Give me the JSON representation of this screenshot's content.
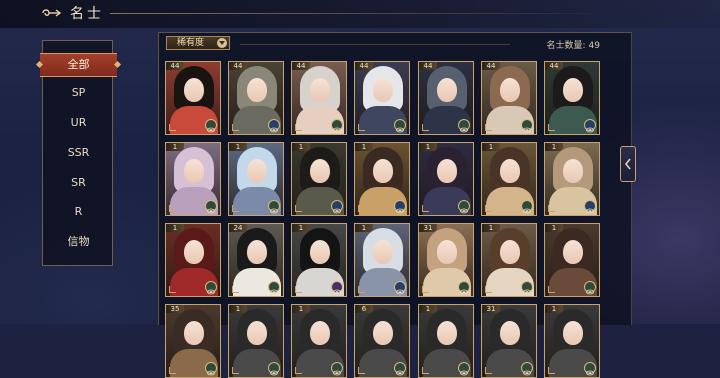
{
  "header": {
    "title": "名士",
    "back_icon": "back-arrow-icon"
  },
  "sidebar": {
    "items": [
      {
        "label": "全部",
        "active": true
      },
      {
        "label": "SP",
        "active": false
      },
      {
        "label": "UR",
        "active": false
      },
      {
        "label": "SSR",
        "active": false
      },
      {
        "label": "SR",
        "active": false
      },
      {
        "label": "R",
        "active": false
      },
      {
        "label": "信物",
        "active": false
      }
    ]
  },
  "toolbar": {
    "sort_label": "稀有度",
    "count_label": "名士数量:",
    "count_value": "49"
  },
  "colors": {
    "accent": "#c9a36a",
    "active_tab": "#9a3a27",
    "bg": "#1c2240"
  },
  "cards": [
    {
      "level": "44",
      "rarity": "green",
      "hair": "#1a1410",
      "robe": "#c94a3a",
      "bg": "#8f3c30"
    },
    {
      "level": "44",
      "rarity": "blue",
      "hair": "#8a8678",
      "robe": "#6b6a60",
      "bg": "#4a4236"
    },
    {
      "level": "44",
      "rarity": "green",
      "hair": "#d8d2cc",
      "robe": "#e6cfc0",
      "bg": "#7a5c50"
    },
    {
      "level": "44",
      "rarity": "green",
      "hair": "#e4e6ea",
      "robe": "#3f4660",
      "bg": "#3a3c52"
    },
    {
      "level": "44",
      "rarity": "green",
      "hair": "#56606e",
      "robe": "#2e3448",
      "bg": "#2c3042"
    },
    {
      "level": "44",
      "rarity": "green",
      "hair": "#8c6a52",
      "robe": "#d8c8b6",
      "bg": "#6a5a48"
    },
    {
      "level": "44",
      "rarity": "blue",
      "hair": "#1c1a1a",
      "robe": "#3c5a50",
      "bg": "#2e3a34"
    },
    {
      "level": "1",
      "rarity": "green",
      "hair": "#d6c0d6",
      "robe": "#b8a0bc",
      "bg": "#7e6c82"
    },
    {
      "level": "1",
      "rarity": "green",
      "hair": "#c4d8ec",
      "robe": "#7a8aa8",
      "bg": "#5a6a84"
    },
    {
      "level": "1",
      "rarity": "blue",
      "hair": "#1e1c18",
      "robe": "#5a5a4a",
      "bg": "#3a3a2e"
    },
    {
      "level": "1",
      "rarity": "blue",
      "hair": "#3a2a22",
      "robe": "#c8a068",
      "bg": "#6a5232"
    },
    {
      "level": "1",
      "rarity": "green",
      "hair": "#2a2230",
      "robe": "#3a3a5a",
      "bg": "#2c2c44"
    },
    {
      "level": "1",
      "rarity": "green",
      "hair": "#4a3428",
      "robe": "#d4b48a",
      "bg": "#6a5638"
    },
    {
      "level": "1",
      "rarity": "blue",
      "hair": "#b49a7a",
      "robe": "#d8c4a0",
      "bg": "#7a6a50"
    },
    {
      "level": "1",
      "rarity": "green",
      "hair": "#5a1a1a",
      "robe": "#a02a2a",
      "bg": "#6a2e24"
    },
    {
      "level": "24",
      "rarity": "green",
      "hair": "#1a1a1a",
      "robe": "#ece8e0",
      "bg": "#5c5a52"
    },
    {
      "level": "1",
      "rarity": "purple",
      "hair": "#141414",
      "robe": "#d8d6d2",
      "bg": "#484848"
    },
    {
      "level": "1",
      "rarity": "blue",
      "hair": "#d8dce4",
      "robe": "#8a94a8",
      "bg": "#5c6478"
    },
    {
      "level": "31",
      "rarity": "green",
      "hair": "#c4a280",
      "robe": "#e0c8aa",
      "bg": "#8a6e52"
    },
    {
      "level": "1",
      "rarity": "green",
      "hair": "#5a3e2c",
      "robe": "#e6d4c2",
      "bg": "#6e5a48"
    },
    {
      "level": "1",
      "rarity": "green",
      "hair": "#3c2a22",
      "robe": "#6a4a38",
      "bg": "#4a3a2e"
    },
    {
      "level": "35",
      "rarity": "green",
      "hair": "#3a2c24",
      "robe": "#8a6a4a",
      "bg": "#4a3a2e"
    },
    {
      "level": "1",
      "rarity": "green",
      "hair": "#2a2a2a",
      "robe": "#4a4a4a",
      "bg": "#3a3a3a"
    },
    {
      "level": "1",
      "rarity": "green",
      "hair": "#2a2a2a",
      "robe": "#4a4a4a",
      "bg": "#3a3a3a"
    },
    {
      "level": "6",
      "rarity": "green",
      "hair": "#2a2a2a",
      "robe": "#4a4a4a",
      "bg": "#3a3a3a"
    },
    {
      "level": "1",
      "rarity": "green",
      "hair": "#2a2a2a",
      "robe": "#4a4a4a",
      "bg": "#3a3a3a"
    },
    {
      "level": "31",
      "rarity": "green",
      "hair": "#2a2a2a",
      "robe": "#4a4a4a",
      "bg": "#3a3a3a"
    },
    {
      "level": "1",
      "rarity": "green",
      "hair": "#2a2a2a",
      "robe": "#4a4a4a",
      "bg": "#3a3a3a"
    }
  ]
}
